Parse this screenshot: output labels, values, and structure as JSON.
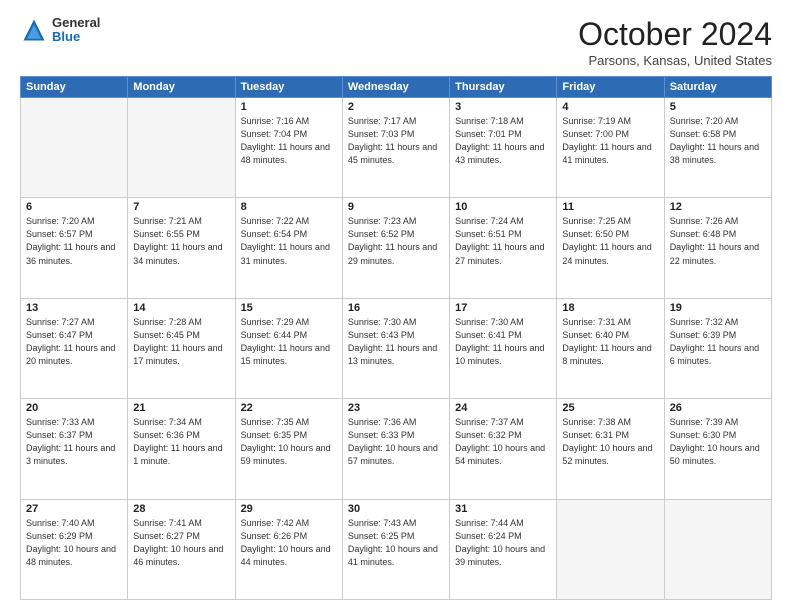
{
  "header": {
    "logo": {
      "general": "General",
      "blue": "Blue"
    },
    "title": "October 2024",
    "location": "Parsons, Kansas, United States"
  },
  "weekdays": [
    "Sunday",
    "Monday",
    "Tuesday",
    "Wednesday",
    "Thursday",
    "Friday",
    "Saturday"
  ],
  "weeks": [
    [
      {
        "day": "",
        "sunrise": "",
        "sunset": "",
        "daylight": ""
      },
      {
        "day": "",
        "sunrise": "",
        "sunset": "",
        "daylight": ""
      },
      {
        "day": "1",
        "sunrise": "Sunrise: 7:16 AM",
        "sunset": "Sunset: 7:04 PM",
        "daylight": "Daylight: 11 hours and 48 minutes."
      },
      {
        "day": "2",
        "sunrise": "Sunrise: 7:17 AM",
        "sunset": "Sunset: 7:03 PM",
        "daylight": "Daylight: 11 hours and 45 minutes."
      },
      {
        "day": "3",
        "sunrise": "Sunrise: 7:18 AM",
        "sunset": "Sunset: 7:01 PM",
        "daylight": "Daylight: 11 hours and 43 minutes."
      },
      {
        "day": "4",
        "sunrise": "Sunrise: 7:19 AM",
        "sunset": "Sunset: 7:00 PM",
        "daylight": "Daylight: 11 hours and 41 minutes."
      },
      {
        "day": "5",
        "sunrise": "Sunrise: 7:20 AM",
        "sunset": "Sunset: 6:58 PM",
        "daylight": "Daylight: 11 hours and 38 minutes."
      }
    ],
    [
      {
        "day": "6",
        "sunrise": "Sunrise: 7:20 AM",
        "sunset": "Sunset: 6:57 PM",
        "daylight": "Daylight: 11 hours and 36 minutes."
      },
      {
        "day": "7",
        "sunrise": "Sunrise: 7:21 AM",
        "sunset": "Sunset: 6:55 PM",
        "daylight": "Daylight: 11 hours and 34 minutes."
      },
      {
        "day": "8",
        "sunrise": "Sunrise: 7:22 AM",
        "sunset": "Sunset: 6:54 PM",
        "daylight": "Daylight: 11 hours and 31 minutes."
      },
      {
        "day": "9",
        "sunrise": "Sunrise: 7:23 AM",
        "sunset": "Sunset: 6:52 PM",
        "daylight": "Daylight: 11 hours and 29 minutes."
      },
      {
        "day": "10",
        "sunrise": "Sunrise: 7:24 AM",
        "sunset": "Sunset: 6:51 PM",
        "daylight": "Daylight: 11 hours and 27 minutes."
      },
      {
        "day": "11",
        "sunrise": "Sunrise: 7:25 AM",
        "sunset": "Sunset: 6:50 PM",
        "daylight": "Daylight: 11 hours and 24 minutes."
      },
      {
        "day": "12",
        "sunrise": "Sunrise: 7:26 AM",
        "sunset": "Sunset: 6:48 PM",
        "daylight": "Daylight: 11 hours and 22 minutes."
      }
    ],
    [
      {
        "day": "13",
        "sunrise": "Sunrise: 7:27 AM",
        "sunset": "Sunset: 6:47 PM",
        "daylight": "Daylight: 11 hours and 20 minutes."
      },
      {
        "day": "14",
        "sunrise": "Sunrise: 7:28 AM",
        "sunset": "Sunset: 6:45 PM",
        "daylight": "Daylight: 11 hours and 17 minutes."
      },
      {
        "day": "15",
        "sunrise": "Sunrise: 7:29 AM",
        "sunset": "Sunset: 6:44 PM",
        "daylight": "Daylight: 11 hours and 15 minutes."
      },
      {
        "day": "16",
        "sunrise": "Sunrise: 7:30 AM",
        "sunset": "Sunset: 6:43 PM",
        "daylight": "Daylight: 11 hours and 13 minutes."
      },
      {
        "day": "17",
        "sunrise": "Sunrise: 7:30 AM",
        "sunset": "Sunset: 6:41 PM",
        "daylight": "Daylight: 11 hours and 10 minutes."
      },
      {
        "day": "18",
        "sunrise": "Sunrise: 7:31 AM",
        "sunset": "Sunset: 6:40 PM",
        "daylight": "Daylight: 11 hours and 8 minutes."
      },
      {
        "day": "19",
        "sunrise": "Sunrise: 7:32 AM",
        "sunset": "Sunset: 6:39 PM",
        "daylight": "Daylight: 11 hours and 6 minutes."
      }
    ],
    [
      {
        "day": "20",
        "sunrise": "Sunrise: 7:33 AM",
        "sunset": "Sunset: 6:37 PM",
        "daylight": "Daylight: 11 hours and 3 minutes."
      },
      {
        "day": "21",
        "sunrise": "Sunrise: 7:34 AM",
        "sunset": "Sunset: 6:36 PM",
        "daylight": "Daylight: 11 hours and 1 minute."
      },
      {
        "day": "22",
        "sunrise": "Sunrise: 7:35 AM",
        "sunset": "Sunset: 6:35 PM",
        "daylight": "Daylight: 10 hours and 59 minutes."
      },
      {
        "day": "23",
        "sunrise": "Sunrise: 7:36 AM",
        "sunset": "Sunset: 6:33 PM",
        "daylight": "Daylight: 10 hours and 57 minutes."
      },
      {
        "day": "24",
        "sunrise": "Sunrise: 7:37 AM",
        "sunset": "Sunset: 6:32 PM",
        "daylight": "Daylight: 10 hours and 54 minutes."
      },
      {
        "day": "25",
        "sunrise": "Sunrise: 7:38 AM",
        "sunset": "Sunset: 6:31 PM",
        "daylight": "Daylight: 10 hours and 52 minutes."
      },
      {
        "day": "26",
        "sunrise": "Sunrise: 7:39 AM",
        "sunset": "Sunset: 6:30 PM",
        "daylight": "Daylight: 10 hours and 50 minutes."
      }
    ],
    [
      {
        "day": "27",
        "sunrise": "Sunrise: 7:40 AM",
        "sunset": "Sunset: 6:29 PM",
        "daylight": "Daylight: 10 hours and 48 minutes."
      },
      {
        "day": "28",
        "sunrise": "Sunrise: 7:41 AM",
        "sunset": "Sunset: 6:27 PM",
        "daylight": "Daylight: 10 hours and 46 minutes."
      },
      {
        "day": "29",
        "sunrise": "Sunrise: 7:42 AM",
        "sunset": "Sunset: 6:26 PM",
        "daylight": "Daylight: 10 hours and 44 minutes."
      },
      {
        "day": "30",
        "sunrise": "Sunrise: 7:43 AM",
        "sunset": "Sunset: 6:25 PM",
        "daylight": "Daylight: 10 hours and 41 minutes."
      },
      {
        "day": "31",
        "sunrise": "Sunrise: 7:44 AM",
        "sunset": "Sunset: 6:24 PM",
        "daylight": "Daylight: 10 hours and 39 minutes."
      },
      {
        "day": "",
        "sunrise": "",
        "sunset": "",
        "daylight": ""
      },
      {
        "day": "",
        "sunrise": "",
        "sunset": "",
        "daylight": ""
      }
    ]
  ]
}
